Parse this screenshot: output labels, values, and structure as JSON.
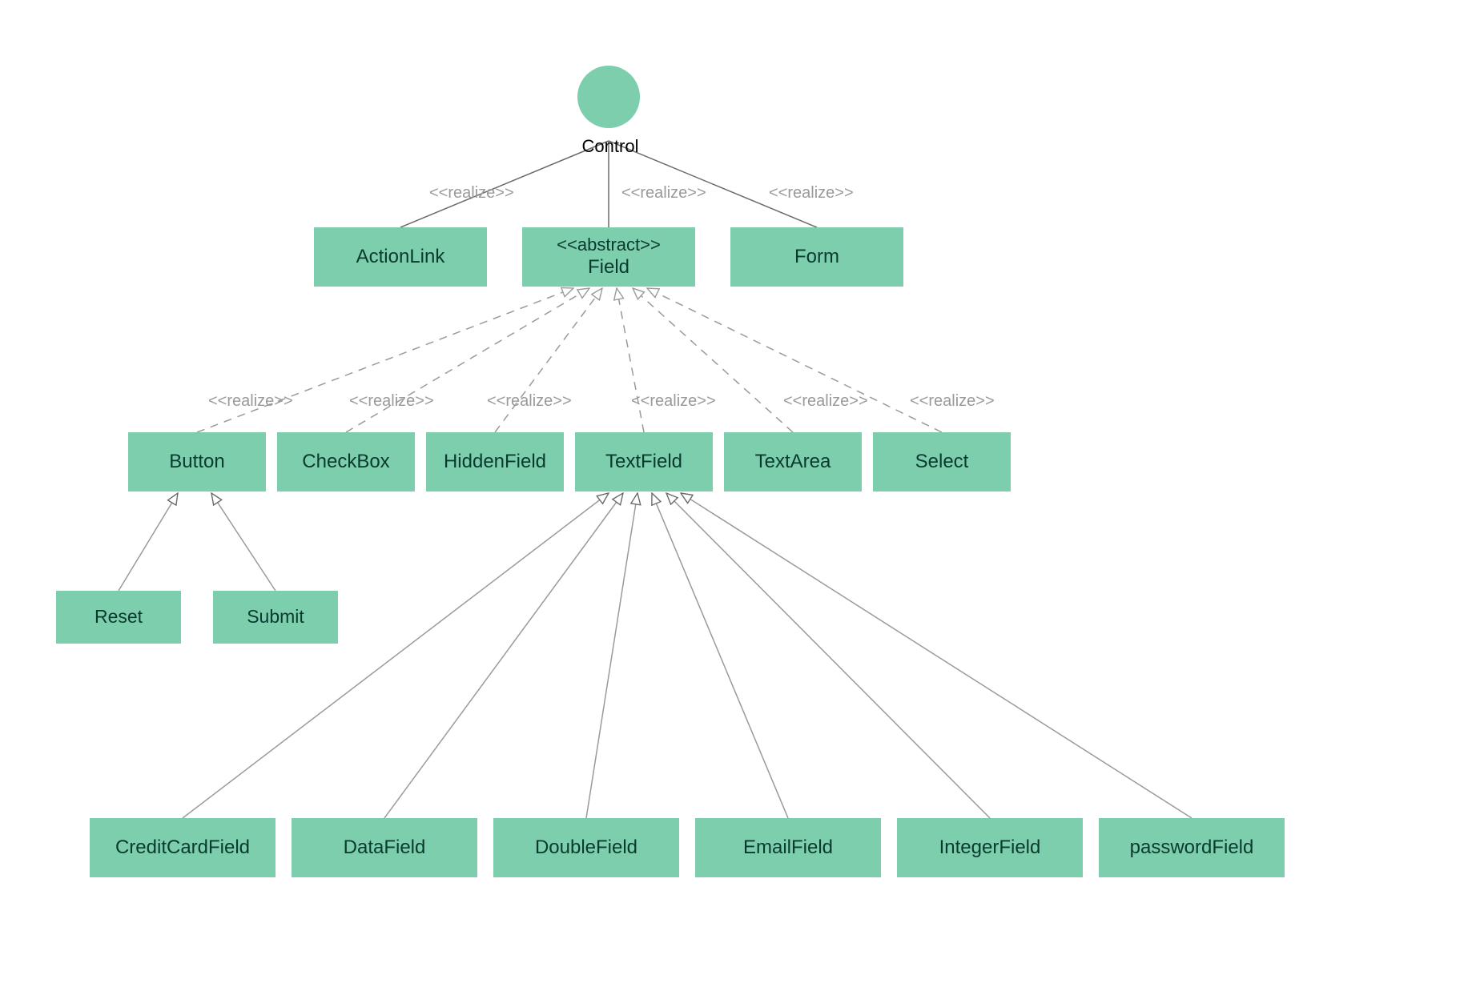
{
  "colors": {
    "node_fill": "#7dceac",
    "node_text": "#083a2f",
    "edge_gray": "#9a9a9a",
    "edge_black": "#4a4a4a"
  },
  "root": {
    "label": "Control"
  },
  "stereotype_abstract": "<<abstract>>",
  "stereotype_realize": "<<realize>>",
  "level1": {
    "actionlink": {
      "label": "ActionLink"
    },
    "field": {
      "stereotype": "<<abstract>>",
      "label": "Field"
    },
    "form": {
      "label": "Form"
    }
  },
  "level2": {
    "button": {
      "label": "Button"
    },
    "checkbox": {
      "label": "CheckBox"
    },
    "hiddenfield": {
      "label": "HiddenField"
    },
    "textfield": {
      "label": "TextField"
    },
    "textarea": {
      "label": "TextArea"
    },
    "select": {
      "label": "Select"
    }
  },
  "button_children": {
    "reset": {
      "label": "Reset"
    },
    "submit": {
      "label": "Submit"
    }
  },
  "textfield_children": {
    "creditcard": {
      "label": "CreditCardField"
    },
    "datafield": {
      "label": "DataField"
    },
    "doublefield": {
      "label": "DoubleField"
    },
    "emailfield": {
      "label": "EmailField"
    },
    "integerfield": {
      "label": "IntegerField"
    },
    "passwordfield": {
      "label": "passwordField"
    }
  },
  "edge_labels": {
    "r1": "<<realize>>",
    "r2": "<<realize>>",
    "r3": "<<realize>>",
    "f1": "<<realize>>",
    "f2": "<<realize>>",
    "f3": "<<realize>>",
    "f4": "<<realize>>",
    "f5": "<<realize>>",
    "f6": "<<realize>>"
  }
}
